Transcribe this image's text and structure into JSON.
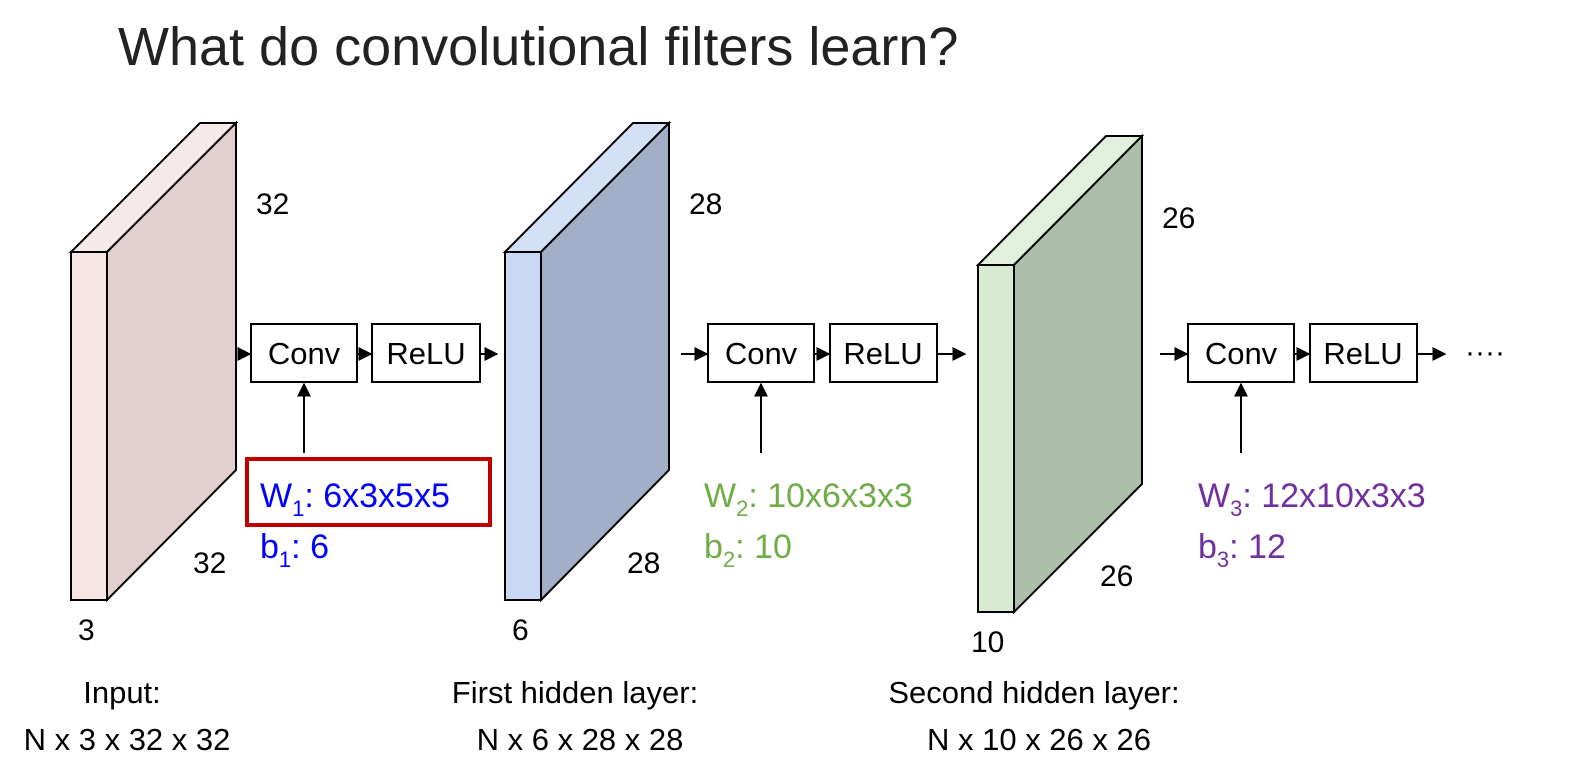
{
  "slide": {
    "title": "What do convolutional filters learn?"
  },
  "volumes": [
    {
      "id": "input",
      "depth": "3",
      "height": "32",
      "width": "32",
      "caption_line1": "Input:",
      "caption_line2": "N x 3 x 32 x 32",
      "front_color": "#f4e4e4",
      "side_color": "#e2cfcf"
    },
    {
      "id": "hidden1",
      "depth": "6",
      "height": "28",
      "width": "28",
      "caption_line1": "First hidden layer:",
      "caption_line2": "N x 6 x 28 x 28",
      "front_color": "#c9d9f4",
      "side_color": "#a3afc8"
    },
    {
      "id": "hidden2",
      "depth": "10",
      "height": "26",
      "width": "26",
      "caption_line1": "Second hidden layer:",
      "caption_line2": "N x 10 x 26 x 26",
      "front_color": "#d9ead3",
      "side_color": "#adbfab"
    }
  ],
  "blocks": {
    "conv_label": "Conv",
    "relu_label": "ReLU",
    "ellipsis": "····"
  },
  "params": [
    {
      "w_sym": "W",
      "w_sub": "1",
      "w_val": ": 6x3x5x5",
      "b_sym": "b",
      "b_sub": "1",
      "b_val": ": 6",
      "color": "#0000ff",
      "highlight_color": "#c00000"
    },
    {
      "w_sym": "W",
      "w_sub": "2",
      "w_val": ": 10x6x3x3",
      "b_sym": "b",
      "b_sub": "2",
      "b_val": ": 10",
      "color": "#70ad47"
    },
    {
      "w_sym": "W",
      "w_sub": "3",
      "w_val": ": 12x10x3x3",
      "b_sym": "b",
      "b_sub": "3",
      "b_val": ": 12",
      "color": "#7030a0"
    }
  ]
}
